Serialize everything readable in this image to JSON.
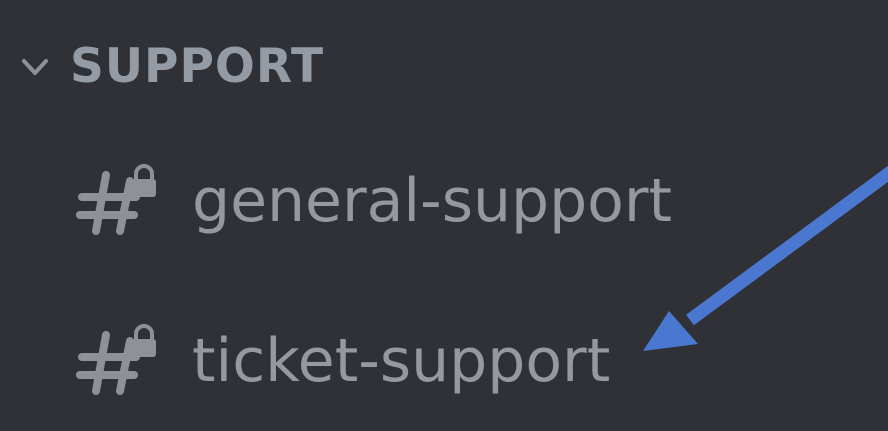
{
  "category": {
    "label": "SUPPORT",
    "icon": "chevron-down-icon",
    "expanded": true
  },
  "channels": [
    {
      "name": "general-support",
      "icon": "locked-hashtag-icon"
    },
    {
      "name": "ticket-support",
      "icon": "locked-hashtag-icon"
    }
  ],
  "colors": {
    "background": "#2f3136",
    "category_text": "#959ba4",
    "channel_text": "#96989d",
    "icon": "#8e9297",
    "annotation_arrow": "#4a78d1"
  },
  "annotation": {
    "type": "arrow",
    "points_to": "ticket-support"
  }
}
